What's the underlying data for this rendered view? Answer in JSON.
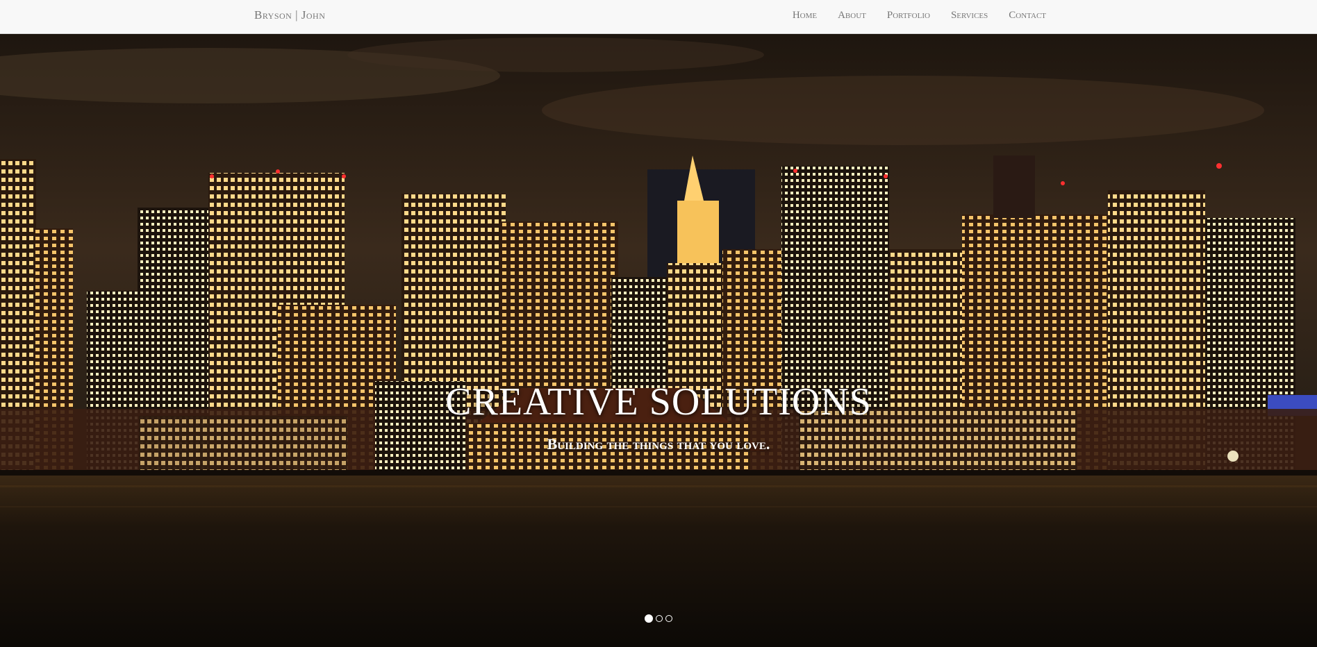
{
  "navbar": {
    "brand": "Bryson | John",
    "links": [
      "Home",
      "About",
      "Portfolio",
      "Services",
      "Contact"
    ]
  },
  "hero": {
    "headline": "CREATIVE SOLUTIONS",
    "subheadline": "Building the things that you love.",
    "slide_count": 3,
    "active_slide": 1
  },
  "colors": {
    "navbar_bg": "#f8f8f8",
    "nav_text": "#777777",
    "caption_text": "#ffffff",
    "sky": "#2a1d14",
    "water": "#1a120b",
    "window_light": "#ffdf8a"
  }
}
